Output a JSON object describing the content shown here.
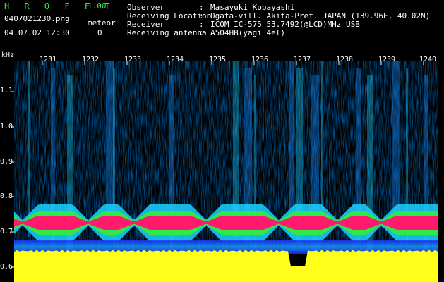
{
  "header": {
    "app_title": "H R O F F T",
    "app_version": "1.00",
    "filename": "0407021230.png",
    "meteor_label": "meteor",
    "datetime": "04.07.02 12:30",
    "meteor_count": "0"
  },
  "info": [
    {
      "label": "Observer",
      "value": "Masayuki Kobayashi"
    },
    {
      "label": "Receiving Location",
      "value": "Ogata-vill. Akita-Pref. JAPAN (139.96E, 40.02N)"
    },
    {
      "label": "Receiver",
      "value": "ICOM IC-575 53.7492(@LCD)MHz USB"
    },
    {
      "label": "Receiving antenna",
      "value": "A504HB(yagi 4el)"
    }
  ],
  "plot": {
    "y_unit": "kHz",
    "y_ticks": [
      "1.1",
      "1.0",
      "0.9",
      "0.8",
      "0.7",
      "0.6"
    ],
    "x_ticks": [
      "1231",
      "1232",
      "1233",
      "1234",
      "1235",
      "1236",
      "1237",
      "1238",
      "1239",
      "1240"
    ],
    "colors": {
      "background": "#000000",
      "signal_band": "#ff1a6e",
      "noise_floor": "#ffff1a",
      "tick": "#ffffff",
      "accent": "#2fe84a"
    }
  }
}
